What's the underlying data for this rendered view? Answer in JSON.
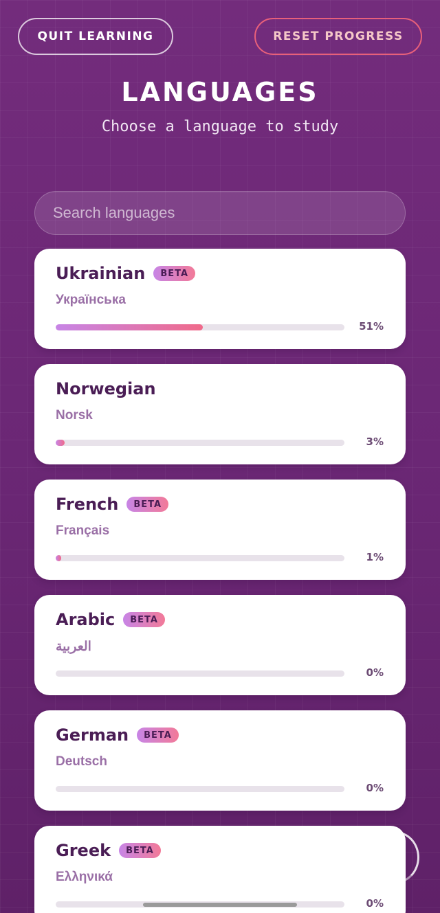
{
  "header": {
    "quit_label": "QUIT LEARNING",
    "reset_label": "RESET PROGRESS",
    "title": "LANGUAGES",
    "subtitle": "Choose a language to study"
  },
  "search": {
    "placeholder": "Search languages",
    "value": ""
  },
  "badge_label": "BETA",
  "languages": [
    {
      "name": "Ukrainian",
      "native": "Українська",
      "beta": true,
      "progress": 51,
      "progress_label": "51%"
    },
    {
      "name": "Norwegian",
      "native": "Norsk",
      "beta": false,
      "progress": 3,
      "progress_label": "3%"
    },
    {
      "name": "French",
      "native": "Français",
      "beta": true,
      "progress": 1,
      "progress_label": "1%"
    },
    {
      "name": "Arabic",
      "native": "العربية",
      "beta": true,
      "progress": 0,
      "progress_label": "0%"
    },
    {
      "name": "German",
      "native": "Deutsch",
      "beta": true,
      "progress": 0,
      "progress_label": "0%"
    },
    {
      "name": "Greek",
      "native": "Ελληνικά",
      "beta": true,
      "progress": 0,
      "progress_label": "0%"
    }
  ],
  "colors": {
    "background": "#6e2a78",
    "card": "#ffffff",
    "title_text": "#4a1d55",
    "native_text": "#9a6fa6",
    "accent_start": "#c785e6",
    "accent_end": "#f06a8a",
    "reset_border": "#e8607a"
  }
}
